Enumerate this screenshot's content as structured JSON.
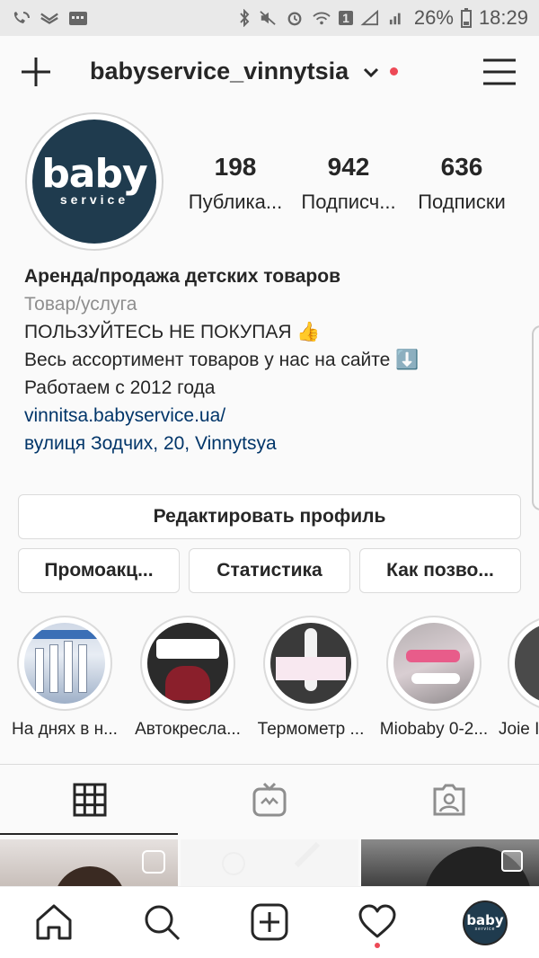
{
  "status_bar": {
    "battery": "26%",
    "time": "18:29",
    "sim_badge": "1"
  },
  "header": {
    "username": "babyservice_vinnytsia"
  },
  "profile": {
    "logo_top": "baby",
    "logo_bottom": "service",
    "stats": [
      {
        "number": "198",
        "label": "Публика..."
      },
      {
        "number": "942",
        "label": "Подписч..."
      },
      {
        "number": "636",
        "label": "Подписки"
      }
    ],
    "bio": {
      "name": "Аренда/продажа детских товаров",
      "category": "Товар/услуга",
      "line1": "ПОЛЬЗУЙТЕСЬ НЕ ПОКУПАЯ 👍",
      "line2": "Весь ассортимент товаров у нас на сайте ⬇️",
      "line3": "Работаем с 2012 года",
      "website": "vinnitsa.babyservice.ua/",
      "address": "вулиця Зодчих, 20, Vinnytsya"
    }
  },
  "buttons": {
    "edit_profile": "Редактировать профиль",
    "promo": "Промоакц...",
    "stats": "Статистика",
    "contact": "Как позво..."
  },
  "highlights": [
    {
      "label": "На днях в н..."
    },
    {
      "label": "Автокресла..."
    },
    {
      "label": "Термометр ..."
    },
    {
      "label": "Miobaby 0-2..."
    },
    {
      "label": "Joie I"
    }
  ],
  "colors": {
    "accent_blue_link": "#003569",
    "brand_navy": "#1f3b4e",
    "notification_red": "#ed4956",
    "muted_gray": "#8e8e8e"
  },
  "icons": {
    "header": [
      "plus-icon",
      "chevron-down-icon",
      "hamburger-menu-icon"
    ],
    "tabs": [
      "grid-icon",
      "igtv-icon",
      "tagged-person-icon"
    ],
    "bottom_nav": [
      "home-icon",
      "search-icon",
      "add-post-icon",
      "heart-icon",
      "profile-avatar"
    ]
  }
}
